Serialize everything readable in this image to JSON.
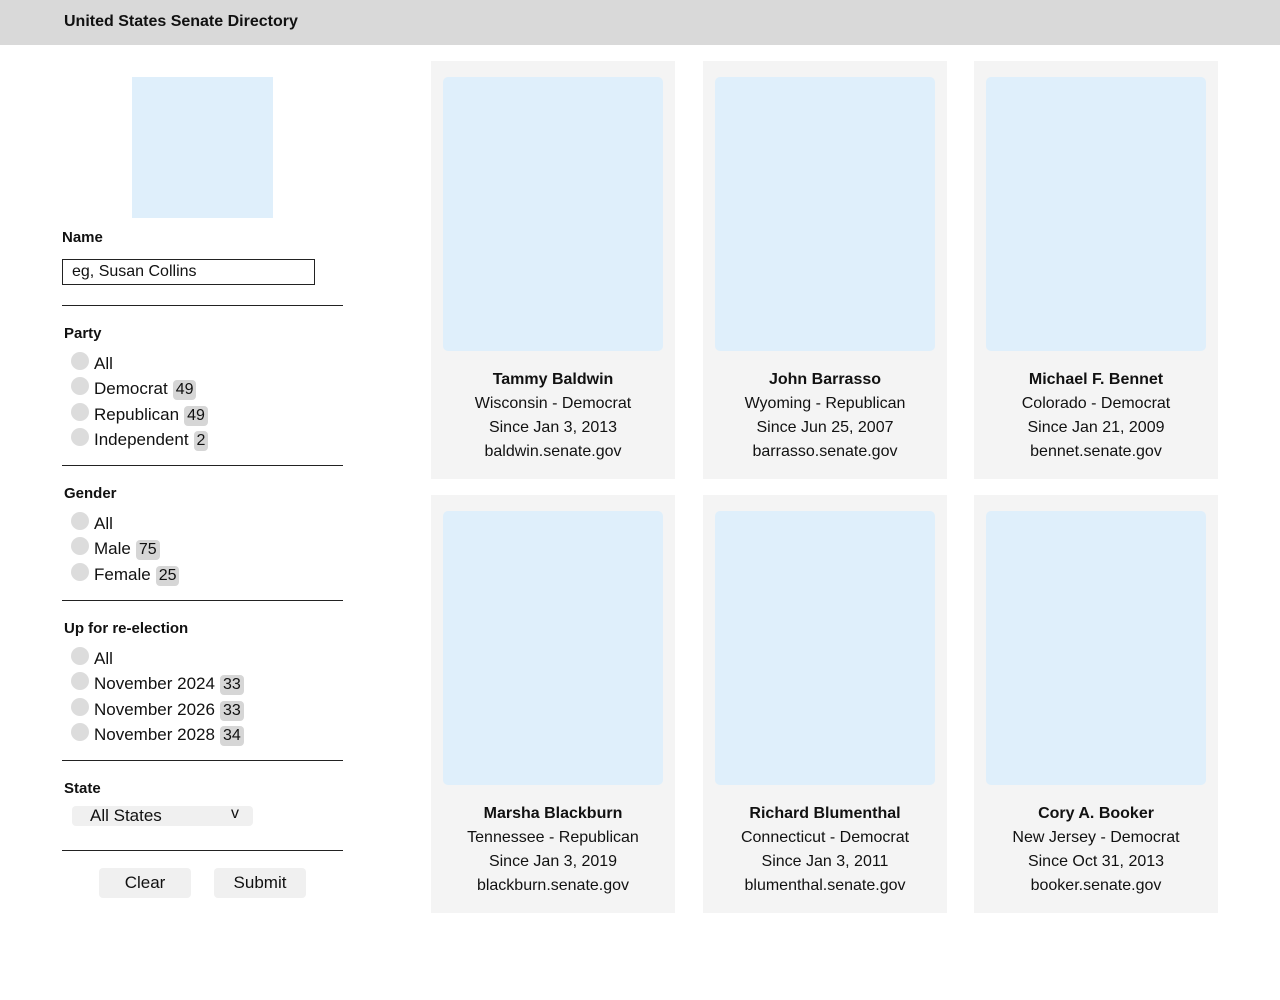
{
  "header": {
    "title": "United States Senate Directory"
  },
  "filters": {
    "name": {
      "label": "Name",
      "placeholder": "eg, Susan Collins"
    },
    "party": {
      "label": "Party",
      "options": [
        {
          "label": "All",
          "count": ""
        },
        {
          "label": "Democrat",
          "count": "49"
        },
        {
          "label": "Republican",
          "count": "49"
        },
        {
          "label": "Independent",
          "count": "2"
        }
      ]
    },
    "gender": {
      "label": "Gender",
      "options": [
        {
          "label": "All",
          "count": ""
        },
        {
          "label": "Male",
          "count": "75"
        },
        {
          "label": "Female",
          "count": "25"
        }
      ]
    },
    "reelection": {
      "label": "Up for re-election",
      "options": [
        {
          "label": "All",
          "count": ""
        },
        {
          "label": "November 2024",
          "count": "33"
        },
        {
          "label": "November 2026",
          "count": "33"
        },
        {
          "label": "November 2028",
          "count": "34"
        }
      ]
    },
    "state": {
      "label": "State",
      "selected": "All States",
      "chevron": "v"
    }
  },
  "actions": {
    "clear_label": "Clear",
    "submit_label": "Submit"
  },
  "senators": [
    {
      "name": "Tammy Baldwin",
      "state_party": "Wisconsin - Democrat",
      "since": "Since Jan 3, 2013",
      "website": "baldwin.senate.gov"
    },
    {
      "name": "John Barrasso",
      "state_party": "Wyoming - Republican",
      "since": "Since Jun 25, 2007",
      "website": "barrasso.senate.gov"
    },
    {
      "name": "Michael F. Bennet",
      "state_party": "Colorado - Democrat",
      "since": "Since Jan 21, 2009",
      "website": "bennet.senate.gov"
    },
    {
      "name": "Marsha Blackburn",
      "state_party": "Tennessee - Republican",
      "since": "Since Jan 3, 2019",
      "website": "blackburn.senate.gov"
    },
    {
      "name": "Richard Blumenthal",
      "state_party": "Connecticut - Democrat",
      "since": "Since Jan 3, 2011",
      "website": "blumenthal.senate.gov"
    },
    {
      "name": "Cory A. Booker",
      "state_party": "New Jersey - Democrat",
      "since": "Since Oct 31, 2013",
      "website": "booker.senate.gov"
    }
  ]
}
